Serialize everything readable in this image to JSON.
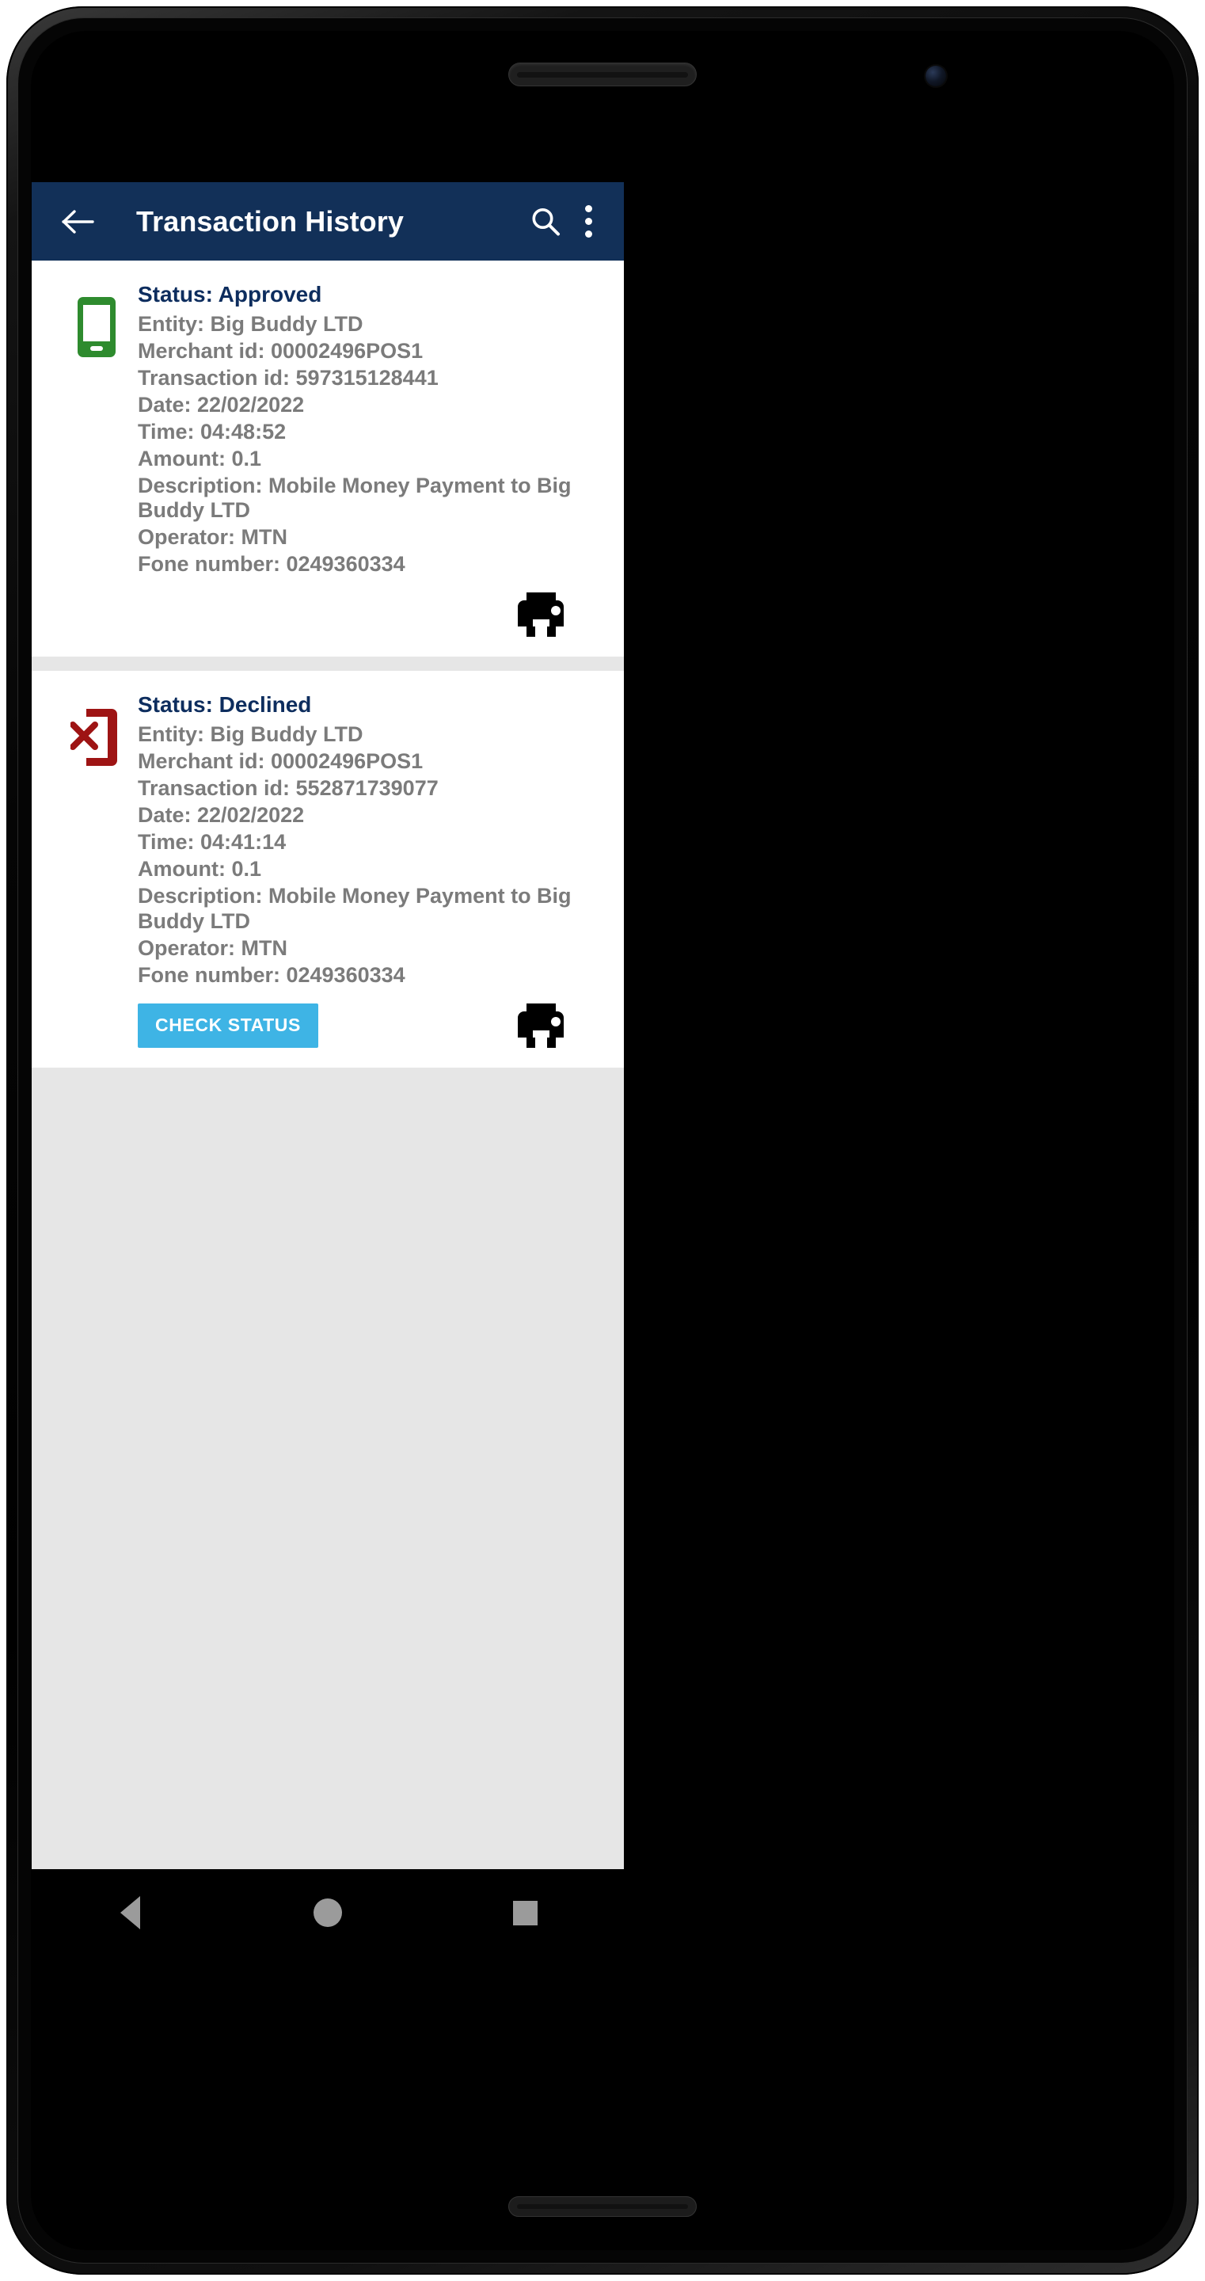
{
  "appbar": {
    "title": "Transaction History",
    "back_icon": "arrow-back-icon",
    "search_icon": "search-icon",
    "overflow_icon": "more-vert-icon",
    "background_color": "#123058",
    "title_color": "#FFFFFF"
  },
  "colors": {
    "status_text": "#0D2D5E",
    "detail_text": "#7B7B7B",
    "approved_icon": "#2E8B2E",
    "declined_icon": "#9E1414",
    "button_blue": "#3EB4E5",
    "list_background": "#E6E6E6",
    "card_background": "#FFFFFF"
  },
  "transactions": [
    {
      "icon": "phone-approved-icon",
      "icon_color": "#2E8B2E",
      "status": "Status: Approved",
      "entity": "Entity: Big Buddy LTD",
      "merchant_id": "Merchant id: 00002496POS1",
      "transaction_id": "Transaction id: 597315128441",
      "date": "Date: 22/02/2022",
      "time": "Time: 04:48:52",
      "amount": "Amount: 0.1",
      "description": "Description: Mobile Money Payment  to Big Buddy LTD",
      "operator": "Operator: MTN",
      "fone_number": "Fone number: 0249360334",
      "has_check_status": false,
      "print_icon": "printer-icon"
    },
    {
      "icon": "phone-declined-icon",
      "icon_color": "#9E1414",
      "status": "Status: Declined",
      "entity": "Entity: Big Buddy LTD",
      "merchant_id": "Merchant id: 00002496POS1",
      "transaction_id": "Transaction id: 552871739077",
      "date": "Date: 22/02/2022",
      "time": "Time: 04:41:14",
      "amount": "Amount: 0.1",
      "description": "Description: Mobile Money Payment  to Big Buddy LTD",
      "operator": "Operator: MTN",
      "fone_number": "Fone number: 0249360334",
      "has_check_status": true,
      "check_status_label": "CHECK STATUS",
      "print_icon": "printer-icon"
    }
  ],
  "navbar": {
    "back": "nav-back-icon",
    "home": "nav-home-icon",
    "recents": "nav-recents-icon"
  }
}
